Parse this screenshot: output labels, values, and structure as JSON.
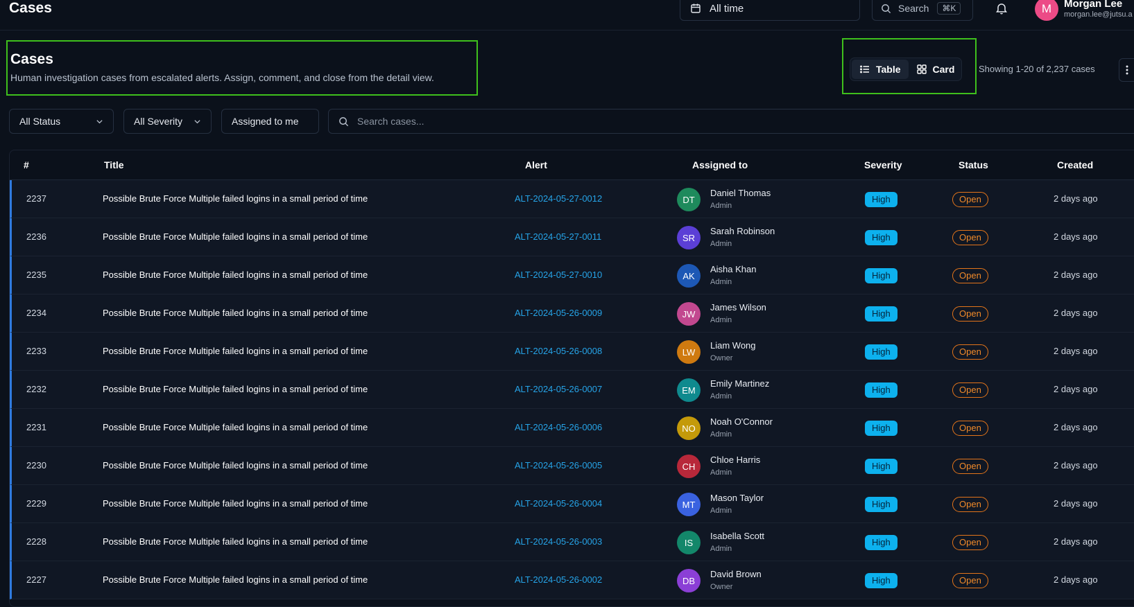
{
  "topbar": {
    "app_title": "Cases",
    "date_range": "All time",
    "search_label": "Search",
    "search_shortcut": "⌘K",
    "user": {
      "initial": "M",
      "name": "Morgan Lee",
      "email": "morgan.lee@jutsu.a"
    }
  },
  "header": {
    "title": "Cases",
    "subtitle": "Human investigation cases from escalated alerts. Assign, comment, and close from the detail view."
  },
  "view_toggle": {
    "table_label": "Table",
    "card_label": "Card",
    "active": "table"
  },
  "showing_text": "Showing 1-20 of 2,237 cases",
  "filters": {
    "status": "All Status",
    "severity": "All Severity",
    "assigned": "Assigned to me",
    "search_placeholder": "Search cases..."
  },
  "table": {
    "columns": {
      "num": "#",
      "title": "Title",
      "alert": "Alert",
      "assigned": "Assigned to",
      "severity": "Severity",
      "status": "Status",
      "created": "Created"
    },
    "rows": [
      {
        "num": "2237",
        "title": "Possible Brute Force Multiple failed logins in a small period of time",
        "alert": "ALT-2024-05-27-0012",
        "initials": "DT",
        "avatar_color": "#1e8a5c",
        "name": "Daniel Thomas",
        "role": "Admin",
        "severity": "High",
        "status": "Open",
        "created": "2 days ago"
      },
      {
        "num": "2236",
        "title": "Possible Brute Force Multiple failed logins in a small period of time",
        "alert": "ALT-2024-05-27-0011",
        "initials": "SR",
        "avatar_color": "#5b3fd6",
        "name": "Sarah Robinson",
        "role": "Admin",
        "severity": "High",
        "status": "Open",
        "created": "2 days ago"
      },
      {
        "num": "2235",
        "title": "Possible Brute Force Multiple failed logins in a small period of time",
        "alert": "ALT-2024-05-27-0010",
        "initials": "AK",
        "avatar_color": "#1d58b5",
        "name": "Aisha Khan",
        "role": "Admin",
        "severity": "High",
        "status": "Open",
        "created": "2 days ago"
      },
      {
        "num": "2234",
        "title": "Possible Brute Force Multiple failed logins in a small period of time",
        "alert": "ALT-2024-05-26-0009",
        "initials": "JW",
        "avatar_color": "#c2488f",
        "name": "James Wilson",
        "role": "Admin",
        "severity": "High",
        "status": "Open",
        "created": "2 days ago"
      },
      {
        "num": "2233",
        "title": "Possible Brute Force Multiple failed logins in a small period of time",
        "alert": "ALT-2024-05-26-0008",
        "initials": "LW",
        "avatar_color": "#cf7a10",
        "name": "Liam Wong",
        "role": "Owner",
        "severity": "High",
        "status": "Open",
        "created": "2 days ago"
      },
      {
        "num": "2232",
        "title": "Possible Brute Force Multiple failed logins in a small period of time",
        "alert": "ALT-2024-05-26-0007",
        "initials": "EM",
        "avatar_color": "#0f8a8e",
        "name": "Emily Martinez",
        "role": "Admin",
        "severity": "High",
        "status": "Open",
        "created": "2 days ago"
      },
      {
        "num": "2231",
        "title": "Possible Brute Force Multiple failed logins in a small period of time",
        "alert": "ALT-2024-05-26-0006",
        "initials": "NO",
        "avatar_color": "#c49a0a",
        "name": "Noah O'Connor",
        "role": "Admin",
        "severity": "High",
        "status": "Open",
        "created": "2 days ago"
      },
      {
        "num": "2230",
        "title": "Possible Brute Force Multiple failed logins in a small period of time",
        "alert": "ALT-2024-05-26-0005",
        "initials": "CH",
        "avatar_color": "#b8283a",
        "name": "Chloe Harris",
        "role": "Admin",
        "severity": "High",
        "status": "Open",
        "created": "2 days ago"
      },
      {
        "num": "2229",
        "title": "Possible Brute Force Multiple failed logins in a small period of time",
        "alert": "ALT-2024-05-26-0004",
        "initials": "MT",
        "avatar_color": "#3a62e0",
        "name": "Mason Taylor",
        "role": "Admin",
        "severity": "High",
        "status": "Open",
        "created": "2 days ago"
      },
      {
        "num": "2228",
        "title": "Possible Brute Force Multiple failed logins in a small period of time",
        "alert": "ALT-2024-05-26-0003",
        "initials": "IS",
        "avatar_color": "#13876a",
        "name": "Isabella Scott",
        "role": "Admin",
        "severity": "High",
        "status": "Open",
        "created": "2 days ago"
      },
      {
        "num": "2227",
        "title": "Possible Brute Force Multiple failed logins in a small period of time",
        "alert": "ALT-2024-05-26-0002",
        "initials": "DB",
        "avatar_color": "#8b3fd6",
        "name": "David Brown",
        "role": "Owner",
        "severity": "High",
        "status": "Open",
        "created": "2 days ago"
      }
    ]
  },
  "colors": {
    "accent_link": "#26a4e8",
    "severity_high": "#0db1ee",
    "status_open": "#f08a2a",
    "highlight_box": "#3fc01c"
  },
  "icons": {
    "date": "calendar-icon",
    "search": "search-icon",
    "notifications": "bell-icon",
    "list": "list-icon",
    "grid": "grid-icon",
    "more": "more-vertical-icon",
    "dropdown": "chevron-down-icon"
  }
}
